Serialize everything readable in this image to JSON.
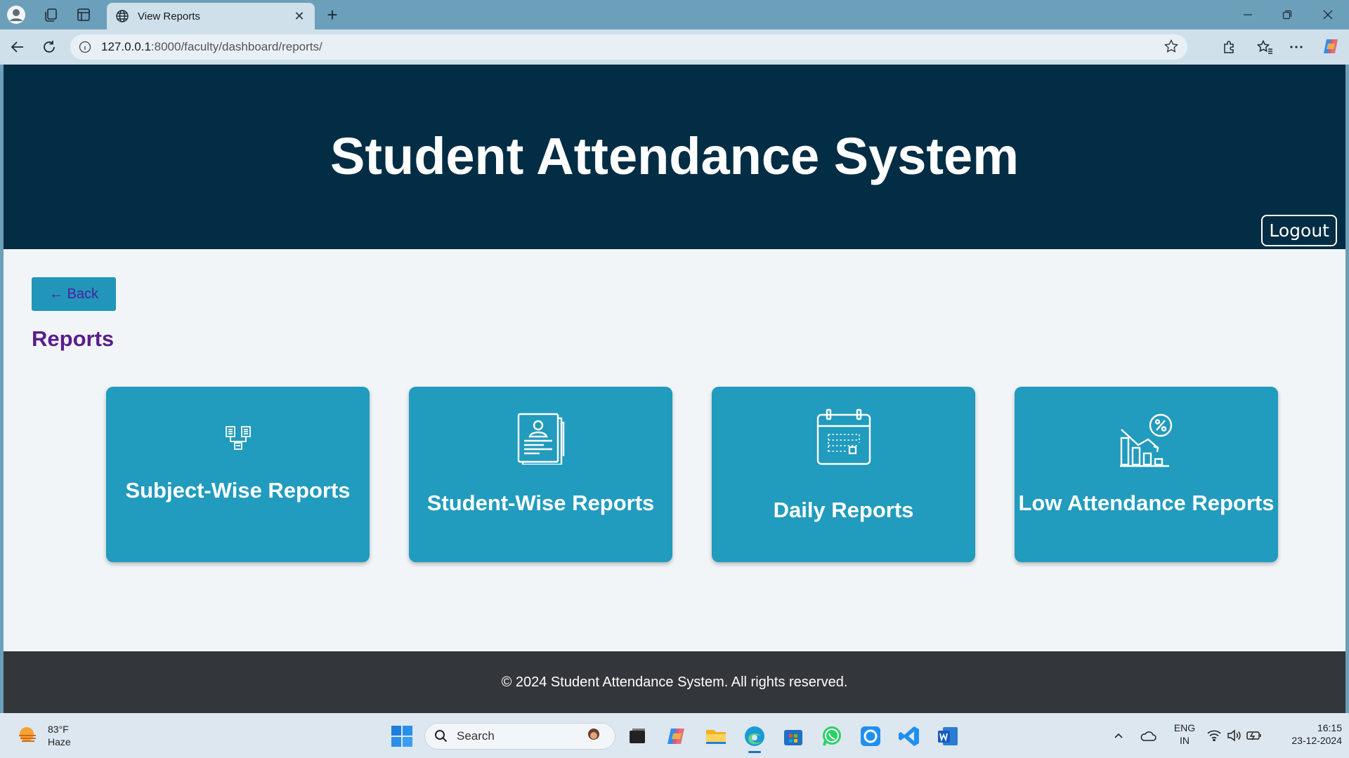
{
  "browser": {
    "tab_title": "View Reports",
    "url_host": "127.0.0.1",
    "url_path": ":8000/faculty/dashboard/reports/"
  },
  "header": {
    "title": "Student Attendance System",
    "logout_label": "Logout"
  },
  "main": {
    "back_label": "← Back",
    "heading": "Reports",
    "cards": [
      {
        "label": "Subject-Wise Reports",
        "icon": "subject-tree-icon"
      },
      {
        "label": "Student-Wise Reports",
        "icon": "student-document-icon"
      },
      {
        "label": "Daily Reports",
        "icon": "calendar-icon"
      },
      {
        "label": "Low Attendance Reports",
        "icon": "chart-percent-icon"
      }
    ]
  },
  "footer": {
    "text": "© 2024 Student Attendance System. All rights reserved."
  },
  "taskbar": {
    "weather_temp": "83°F",
    "weather_desc": "Haze",
    "search_label": "Search",
    "lang_top": "ENG",
    "lang_bottom": "IN",
    "time": "16:15",
    "date": "23-12-2024"
  },
  "colors": {
    "header_bg": "#032d44",
    "card_bg": "#219bbe",
    "heading": "#5a1d8c",
    "footer_bg": "#33363b"
  }
}
